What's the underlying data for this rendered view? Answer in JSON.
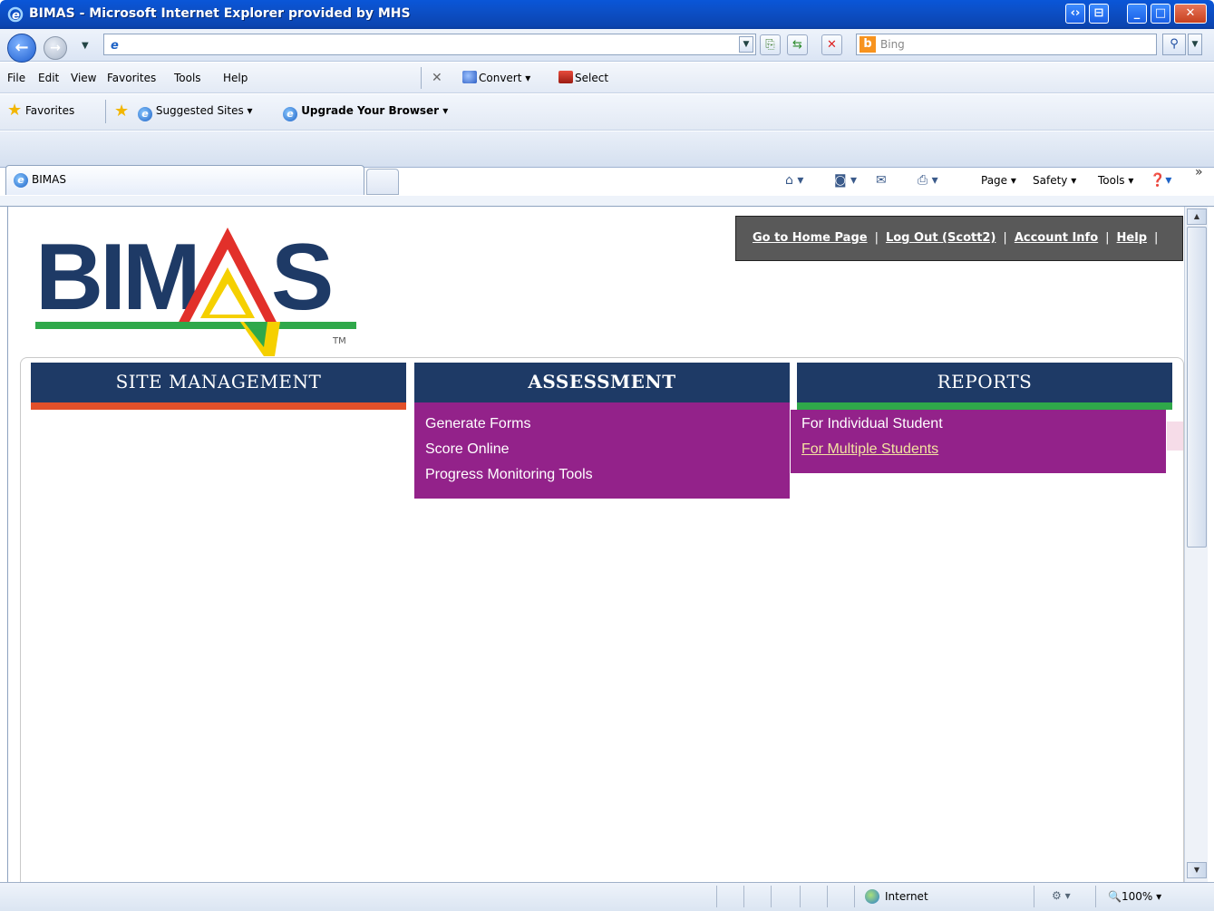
{
  "window": {
    "title": "BIMAS - Microsoft Internet Explorer provided by MHS"
  },
  "browser": {
    "search_placeholder": "Bing",
    "menu": [
      "File",
      "Edit",
      "View",
      "Favorites",
      "Tools",
      "Help"
    ],
    "convert_label": "Convert",
    "select_label": "Select",
    "favorites_label": "Favorites",
    "suggested_sites": "Suggested Sites",
    "upgrade_label": "Upgrade Your Browser",
    "tab_title": "BIMAS",
    "command_bar": {
      "page": "Page",
      "safety": "Safety",
      "tools": "Tools"
    },
    "status": {
      "zone": "Internet",
      "zoom": "100%"
    }
  },
  "site": {
    "logo_text": "BIMAS",
    "logo_tm": "TM",
    "links": {
      "home": "Go to Home Page",
      "logout": "Log Out (Scott2)",
      "account": "Account Info",
      "help": "Help",
      "separator": "|"
    },
    "nav": {
      "site_management": "SITE MANAGEMENT",
      "assessment": "ASSESSMENT",
      "reports": "REPORTS"
    },
    "assessment_menu": {
      "generate_forms": "Generate Forms",
      "score_online": "Score Online",
      "progress_monitoring": "Progress Monitoring Tools"
    },
    "reports_menu": {
      "individual": "For Individual Student",
      "multiple": "For Multiple Students"
    }
  },
  "colors": {
    "nav_blue": "#1e3a66",
    "dropdown_purple": "#93228a",
    "site_strip_red": "#e2502a",
    "reports_strip_green": "#2fa84a",
    "logo_blue": "#1e3a66",
    "logo_red": "#e2302a",
    "logo_yellow": "#f5d000",
    "logo_green": "#2fa84a"
  }
}
